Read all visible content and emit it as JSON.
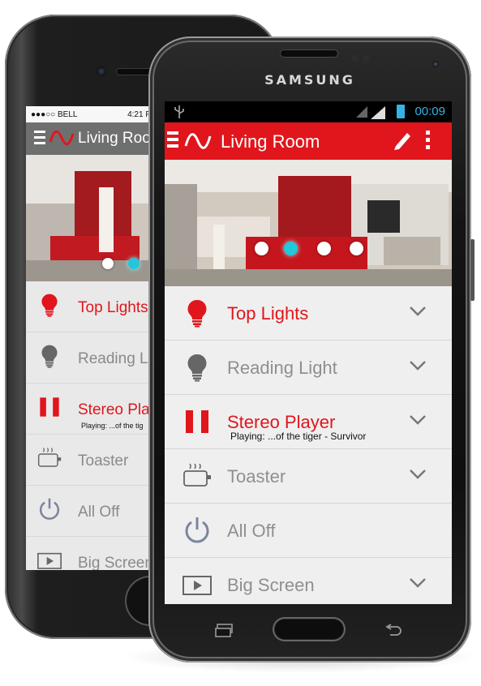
{
  "colors": {
    "accent": "#e0161c",
    "status_blue": "#35b2e6",
    "active_dot": "#22c7d9",
    "label_inactive": "#8f8f8f",
    "list_bg": "#efefef"
  },
  "back_phone": {
    "status": {
      "carrier": "●●●○○ BELL",
      "time": "4:21 P"
    },
    "title": "Living Roo",
    "items": [
      {
        "label": "Top Lights",
        "icon": "bulb-icon",
        "active": true
      },
      {
        "label": "Reading Li",
        "icon": "bulb-icon",
        "active": false
      },
      {
        "label": "Stereo Play",
        "sub": "Playing: ...of the tig",
        "icon": "pause-icon",
        "active": true
      },
      {
        "label": "Toaster",
        "icon": "toaster-icon",
        "active": false
      },
      {
        "label": "All Off",
        "icon": "power-icon",
        "active": false
      },
      {
        "label": "Big Screen",
        "icon": "tv-icon",
        "active": false
      }
    ]
  },
  "device": {
    "brand": "SAMSUNG",
    "status_time": "00:09"
  },
  "app": {
    "title": "Living Room",
    "slider": {
      "count": 4,
      "active_index": 1
    },
    "items": [
      {
        "label": "Top Lights",
        "icon": "bulb-icon",
        "active": true,
        "has_chevron": true
      },
      {
        "label": "Reading Light",
        "icon": "bulb-icon",
        "active": false,
        "has_chevron": true
      },
      {
        "label": "Stereo Player",
        "sub": "Playing: ...of the tiger - Survivor",
        "icon": "pause-icon",
        "active": true,
        "has_chevron": true
      },
      {
        "label": "Toaster",
        "icon": "toaster-icon",
        "active": false,
        "has_chevron": true
      },
      {
        "label": "All Off",
        "icon": "power-icon",
        "active": false,
        "has_chevron": false
      },
      {
        "label": "Big Screen",
        "icon": "tv-icon",
        "active": false,
        "has_chevron": true
      }
    ]
  }
}
